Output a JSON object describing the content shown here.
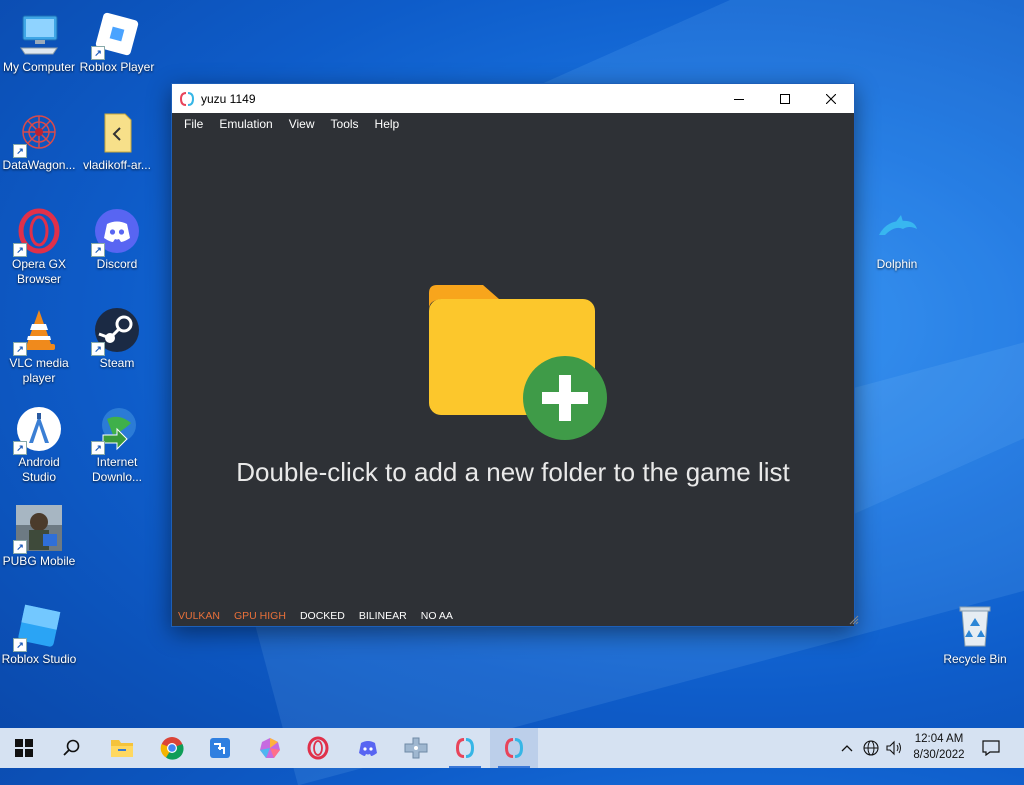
{
  "desktop": {
    "icons": [
      {
        "label": "My Computer",
        "icon": "computer-icon"
      },
      {
        "label": "Roblox Player",
        "icon": "roblox-icon"
      },
      {
        "label": "DataWagon...",
        "icon": "datawagon-icon"
      },
      {
        "label": "vladikoff-ar...",
        "icon": "folder-zip-icon"
      },
      {
        "label": "Opera GX Browser",
        "icon": "opera-gx-icon"
      },
      {
        "label": "Discord",
        "icon": "discord-icon"
      },
      {
        "label": "VLC media player",
        "icon": "vlc-icon"
      },
      {
        "label": "Steam",
        "icon": "steam-icon"
      },
      {
        "label": "Android Studio",
        "icon": "android-studio-icon"
      },
      {
        "label": "Internet Downlo...",
        "icon": "idm-icon"
      },
      {
        "label": "PUBG Mobile",
        "icon": "pubg-icon"
      },
      {
        "label": "Roblox Studio",
        "icon": "roblox-studio-icon"
      },
      {
        "label": "Dolphin",
        "icon": "dolphin-icon"
      },
      {
        "label": "Recycle Bin",
        "icon": "recycle-bin-icon"
      }
    ]
  },
  "window": {
    "title": "yuzu 1149",
    "menu": [
      "File",
      "Emulation",
      "View",
      "Tools",
      "Help"
    ],
    "empty_message": "Double-click to add a new folder to the game list",
    "status": [
      {
        "label": "VULKAN",
        "color": "#e8703a"
      },
      {
        "label": "GPU HIGH",
        "color": "#e8703a"
      },
      {
        "label": "DOCKED",
        "color": "#ffffff"
      },
      {
        "label": "BILINEAR",
        "color": "#ffffff"
      },
      {
        "label": "NO AA",
        "color": "#ffffff"
      }
    ],
    "colors": {
      "background": "#2e3136",
      "folder": "#fcc72c",
      "plus_circle": "#3f9b48"
    }
  },
  "taskbar": {
    "items": [
      "start-icon",
      "search-icon",
      "file-explorer-icon",
      "chrome-icon",
      "taskbar-app-icon",
      "photos-icon",
      "opera-icon",
      "discord-icon",
      "game-controller-icon",
      "yuzu-icon",
      "yuzu-icon"
    ],
    "time": "12:04 AM",
    "date": "8/30/2022"
  }
}
